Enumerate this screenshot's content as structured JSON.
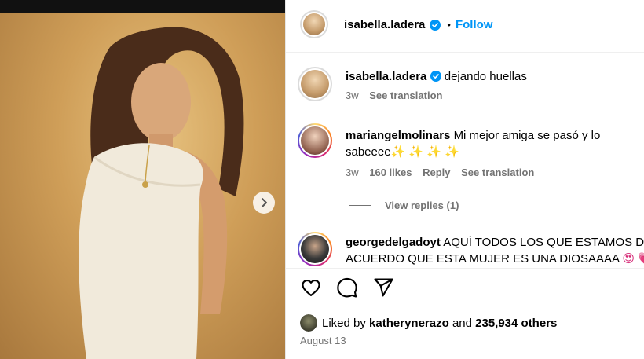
{
  "header": {
    "username": "isabella.ladera",
    "separator": "•",
    "follow_label": "Follow"
  },
  "caption": {
    "username": "isabella.ladera",
    "text": "dejando huellas",
    "time": "3w",
    "translate": "See translation"
  },
  "comments": [
    {
      "username": "mariangelmolinars",
      "text_line1": "Mi mejor amiga se pasó y lo",
      "text_line2": "sabeeee",
      "emojis": "✨ ✨ ✨ ✨",
      "time": "3w",
      "likes": "160 likes",
      "reply": "Reply",
      "translate": "See translation",
      "view_replies": "View replies (1)"
    },
    {
      "username": "georgedelgadoyt",
      "text_line1": "AQUÍ TODOS LOS QUE ESTAMOS DE",
      "text_line2": "ACUERDO QUE ESTA MUJER ES UNA DIOSAAAA",
      "emojis": "😍 💗"
    }
  ],
  "likes": {
    "prefix": "Liked by",
    "user": "katherynerazo",
    "middle": "and",
    "count": "235,934 others"
  },
  "date": "August 13",
  "colors": {
    "accent": "#0095f6",
    "meta_gray": "#737373"
  },
  "icons": {
    "verified": "verified-badge-icon",
    "next": "chevron-right-icon",
    "like": "heart-icon",
    "comment": "comment-bubble-icon",
    "share": "paper-plane-icon"
  }
}
